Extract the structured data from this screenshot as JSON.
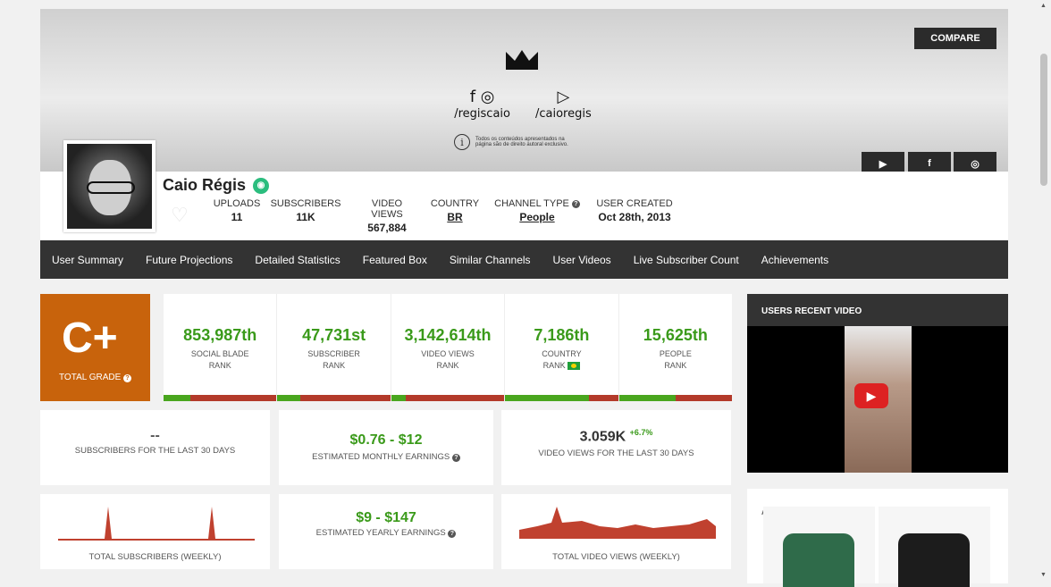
{
  "banner": {
    "facebook_handle": "/regiscaio",
    "youtube_handle": "/caioregis",
    "copyright_line1": "Todos os conteúdos apresentados na",
    "copyright_line2": "página são de direito autoral exclusivo.",
    "compare_label": "COMPARE",
    "social_buttons": [
      "youtube-icon",
      "facebook-icon",
      "instagram-icon"
    ]
  },
  "profile": {
    "name": "Caio Régis",
    "stats": {
      "uploads_label": "UPLOADS",
      "uploads": "11",
      "subscribers_label": "SUBSCRIBERS",
      "subscribers": "11K",
      "video_views_label": "VIDEO VIEWS",
      "video_views": "567,884",
      "country_label": "COUNTRY",
      "country": "BR",
      "channel_type_label": "CHANNEL TYPE",
      "channel_type": "People",
      "user_created_label": "USER CREATED",
      "user_created": "Oct 28th, 2013"
    }
  },
  "nav": [
    "User Summary",
    "Future Projections",
    "Detailed Statistics",
    "Featured Box",
    "Similar Channels",
    "User Videos",
    "Live Subscriber Count",
    "Achievements"
  ],
  "grade": {
    "value": "C+",
    "label": "TOTAL GRADE"
  },
  "ranks": [
    {
      "num": "853,987th",
      "l1": "SOCIAL BLADE",
      "l2": "RANK",
      "fill": 0.24
    },
    {
      "num": "47,731st",
      "l1": "SUBSCRIBER",
      "l2": "RANK",
      "fill": 0.2
    },
    {
      "num": "3,142,614th",
      "l1": "VIDEO VIEWS",
      "l2": "RANK",
      "fill": 0.13
    },
    {
      "num": "7,186th",
      "l1": "COUNTRY",
      "l2": "RANK",
      "fill": 0.74
    },
    {
      "num": "15,625th",
      "l1": "PEOPLE",
      "l2": "RANK",
      "fill": 0.5
    }
  ],
  "summary": {
    "subs30_value": "--",
    "subs30_label": "SUBSCRIBERS FOR THE LAST 30 DAYS",
    "monthly_value": "$0.76  -  $12",
    "monthly_label": "ESTIMATED MONTHLY EARNINGS",
    "views30_value": "3.059K",
    "views30_change": "+6.7%",
    "views30_label": "VIDEO VIEWS FOR THE LAST 30 DAYS",
    "yearly_value": "$9  -  $147",
    "yearly_label": "ESTIMATED YEARLY EARNINGS",
    "weekly_subs_label": "TOTAL SUBSCRIBERS (WEEKLY)",
    "weekly_views_label": "TOTAL VIDEO VIEWS (WEEKLY)"
  },
  "recent_video": {
    "header": "USERS RECENT VIDEO"
  },
  "ad": {
    "label": "AD",
    "close": "ⓘ✕"
  },
  "colors": {
    "accent_green": "#3a9a1a",
    "grade_orange": "#c8630c",
    "bar_red": "#b33a2a",
    "nav_dark": "#333333"
  }
}
